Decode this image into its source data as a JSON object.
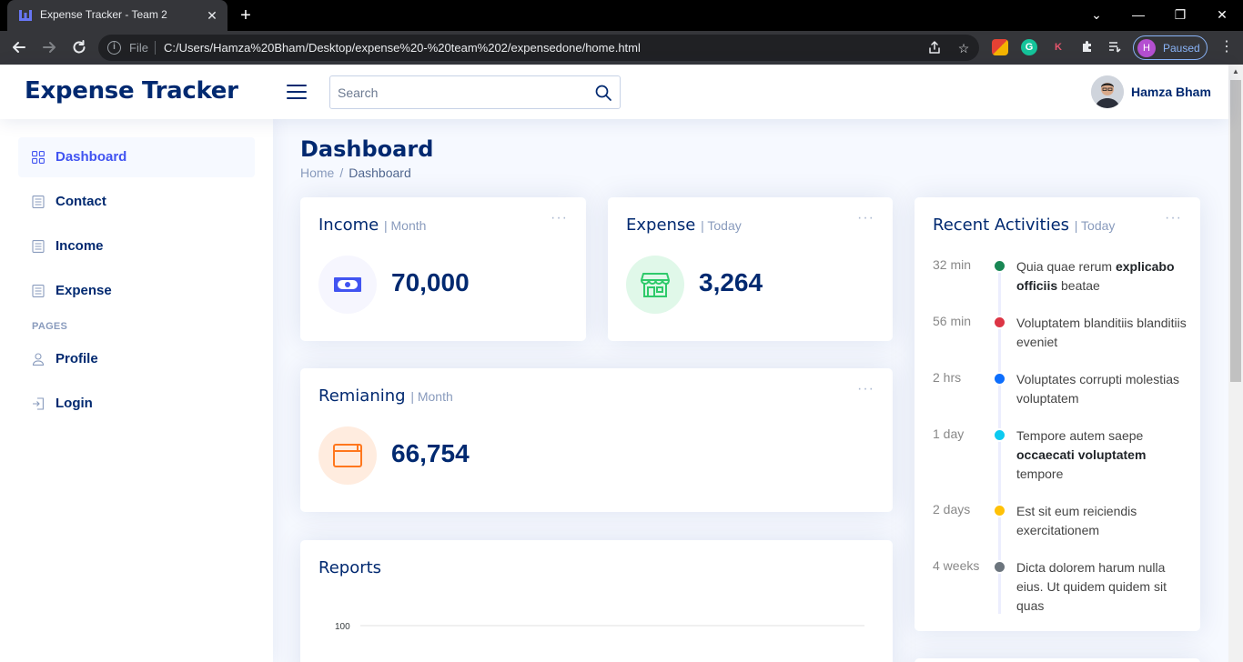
{
  "browser": {
    "tab_title": "Expense Tracker - Team 2",
    "tab_close": "✕",
    "new_tab": "+",
    "scheme_label": "File",
    "url": "C:/Users/Hamza%20Bham/Desktop/expense%20-%20team%202/expensedone/home.html",
    "profile_initial": "H",
    "profile_status": "Paused",
    "window_controls": [
      "⌄",
      "—",
      "❐",
      "✕"
    ]
  },
  "header": {
    "logo": "Expense Tracker",
    "search_placeholder": "Search",
    "user_name": "Hamza Bham"
  },
  "sidebar": {
    "items": [
      {
        "label": "Dashboard",
        "icon": "grid-icon",
        "active": true
      },
      {
        "label": "Contact",
        "icon": "document-icon"
      },
      {
        "label": "Income",
        "icon": "document-icon"
      },
      {
        "label": "Expense",
        "icon": "document-icon"
      }
    ],
    "heading": "PAGES",
    "pages": [
      {
        "label": "Profile",
        "icon": "person-icon"
      },
      {
        "label": "Login",
        "icon": "login-icon"
      }
    ]
  },
  "page": {
    "title": "Dashboard",
    "breadcrumb": [
      "Home",
      "/",
      "Dashboard"
    ]
  },
  "cards": {
    "income": {
      "title": "Income",
      "sub": "| Month",
      "value": "70,000",
      "icon": "money-icon",
      "color": "#4154f1",
      "bg": "#f6f6fe"
    },
    "expense": {
      "title": "Expense",
      "sub": "| Today",
      "value": "3,264",
      "icon": "shop-icon",
      "color": "#2eca6a",
      "bg": "#e0f8e9"
    },
    "remaining": {
      "title": "Remianing",
      "sub": "| Month",
      "value": "66,754",
      "icon": "wallet-icon",
      "color": "#ff771d",
      "bg": "#ffecdf"
    },
    "reports": {
      "title": "Reports"
    },
    "more_glyph": "···"
  },
  "chart_data": {
    "type": "line",
    "title": "Reports",
    "y_ticks": [
      "100"
    ],
    "series": []
  },
  "activities": {
    "title": "Recent Activities",
    "sub": "| Today",
    "items": [
      {
        "time": "32 min",
        "color": "#198754",
        "text_before": "Quia quae rerum ",
        "bold": "explicabo officiis",
        "text_after": " beatae"
      },
      {
        "time": "56 min",
        "color": "#dc3545",
        "text_before": "Voluptatem blanditiis blanditiis eveniet",
        "bold": "",
        "text_after": ""
      },
      {
        "time": "2 hrs",
        "color": "#0d6efd",
        "text_before": "Voluptates corrupti molestias voluptatem",
        "bold": "",
        "text_after": ""
      },
      {
        "time": "1 day",
        "color": "#0dcaf0",
        "text_before": "Tempore autem saepe ",
        "bold": "occaecati voluptatem",
        "text_after": " tempore"
      },
      {
        "time": "2 days",
        "color": "#ffc107",
        "text_before": "Est sit eum reiciendis exercitationem",
        "bold": "",
        "text_after": ""
      },
      {
        "time": "4 weeks",
        "color": "#6c757d",
        "text_before": "Dicta dolorem harum nulla eius. Ut quidem quidem sit quas",
        "bold": "",
        "text_after": ""
      }
    ]
  }
}
